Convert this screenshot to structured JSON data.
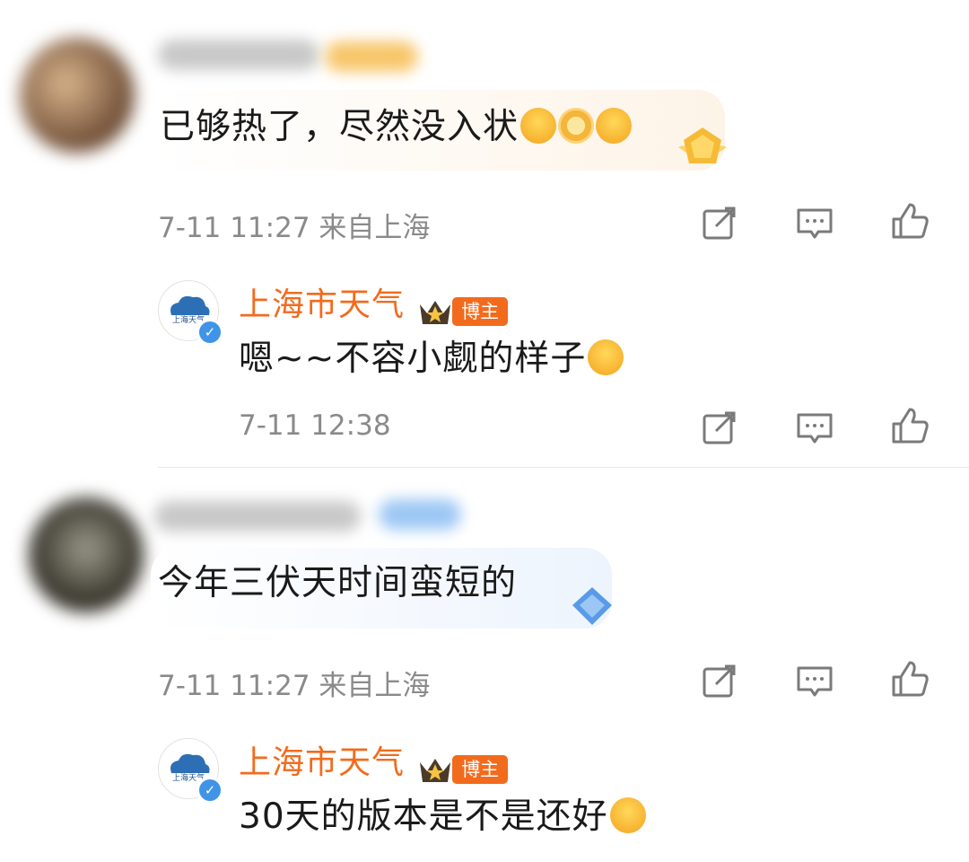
{
  "comments": [
    {
      "text": "已够热了，尽然没入状",
      "meta": "7-11 11:27 来自上海",
      "emojis": [
        "blushing-face-emoji",
        "sunflower-emoji",
        "shocked-face-emoji"
      ],
      "bubble_color": "#fdf4e8",
      "badge_color": "#f5b83a",
      "reply": {
        "author": "上海市天气",
        "author_badge": "博主",
        "text": "嗯~~不容小觑的样子",
        "emojis": [
          "glasses-face-emoji"
        ],
        "meta": "7-11 12:38"
      }
    },
    {
      "text": "今年三伏天时间蛮短的",
      "meta": "7-11 11:27 来自上海",
      "emojis": [],
      "bubble_color": "#edf4fd",
      "badge_color": "#5a9be8",
      "reply": {
        "author": "上海市天气",
        "author_badge": "博主",
        "text": "30天的版本是不是还好",
        "emojis": [
          "wink-face-emoji"
        ],
        "meta": ""
      }
    }
  ],
  "avatar_label": "上海天气",
  "colors": {
    "author_name": "#f26b1d",
    "meta_text": "#8a8a8a",
    "icon_stroke": "#7a7a7a"
  },
  "actions": [
    "share-icon",
    "comment-icon",
    "like-icon"
  ]
}
